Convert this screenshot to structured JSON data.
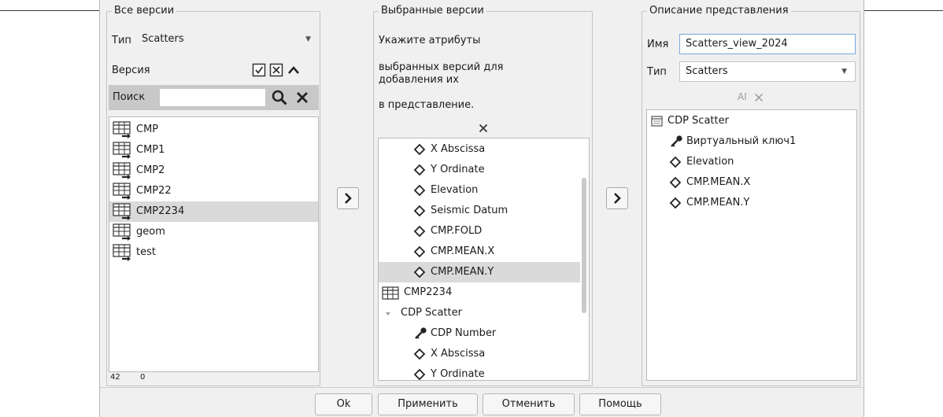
{
  "all_versions": {
    "title": "Все версии",
    "type_label": "Тип",
    "type_value": "Scatters",
    "version_label": "Версия",
    "search_label": "Поиск",
    "search_value": "",
    "items": [
      "CMP",
      "CMP1",
      "CMP2",
      "CMP22",
      "CMP2234",
      "geom",
      "test"
    ],
    "selected_index": 4,
    "status_left": "42",
    "status_right": "0"
  },
  "selected_versions": {
    "title": "Выбранные версии",
    "hint_line1": "Укажите атрибуты",
    "hint_line2": "выбранных версий для добавления их",
    "hint_line3": "в представление.",
    "tree": [
      {
        "text": "X Abscissa",
        "icon": "diamond-icon",
        "level": 2
      },
      {
        "text": "Y Ordinate",
        "icon": "diamond-icon",
        "level": 2
      },
      {
        "text": "Elevation",
        "icon": "diamond-icon",
        "level": 2
      },
      {
        "text": "Seismic Datum",
        "icon": "diamond-icon",
        "level": 2
      },
      {
        "text": "CMP.FOLD",
        "icon": "diamond-icon",
        "level": 2
      },
      {
        "text": "CMP.MEAN.X",
        "icon": "diamond-icon",
        "level": 2
      },
      {
        "text": "CMP.MEAN.Y",
        "icon": "diamond-icon",
        "level": 2,
        "selected": true
      },
      {
        "text": "CMP2234",
        "icon": "table-icon",
        "level": 0
      },
      {
        "text": "CDP Scatter",
        "icon": "expand-arrow-icon",
        "level": 0
      },
      {
        "text": "CDP Number",
        "icon": "key-icon",
        "level": 2
      },
      {
        "text": "X Abscissa",
        "icon": "diamond-icon",
        "level": 2
      },
      {
        "text": "Y Ordinate",
        "icon": "diamond-icon",
        "level": 2
      }
    ]
  },
  "view_description": {
    "title": "Описание представления",
    "name_label": "Имя",
    "name_value": "Scatters_view_2024",
    "type_label": "Тип",
    "type_value": "Scatters",
    "tree": [
      {
        "text": "CDP Scatter",
        "icon": "scatter-table-icon",
        "level": 0
      },
      {
        "text": "Виртуальный ключ1",
        "icon": "key-icon",
        "level": 1
      },
      {
        "text": "Elevation",
        "icon": "diamond-icon",
        "level": 1
      },
      {
        "text": "CMP.MEAN.X",
        "icon": "diamond-icon",
        "level": 1
      },
      {
        "text": "CMP.MEAN.Y",
        "icon": "diamond-icon",
        "level": 1
      }
    ]
  },
  "buttons": {
    "ok": "Ok",
    "apply": "Применить",
    "cancel": "Отменить",
    "help": "Помощь"
  }
}
